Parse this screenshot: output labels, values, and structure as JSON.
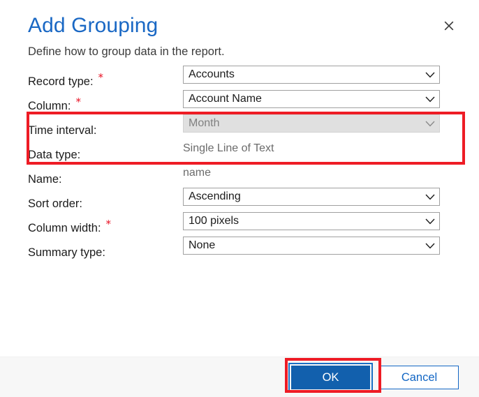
{
  "dialog": {
    "title": "Add Grouping",
    "subtitle": "Define how to group data in the report.",
    "close_icon": "close-icon"
  },
  "form": {
    "rows": [
      {
        "label": "Record type:",
        "required": true,
        "control": "combobox",
        "value": "Accounts",
        "disabled": false,
        "name": "record-type"
      },
      {
        "label": "Column:",
        "required": true,
        "control": "combobox",
        "value": "Account Name",
        "disabled": false,
        "name": "column"
      },
      {
        "label": "Time interval:",
        "required": false,
        "control": "combobox",
        "value": "Month",
        "disabled": true,
        "name": "time-interval"
      },
      {
        "label": "Data type:",
        "required": false,
        "control": "text",
        "value": "Single Line of Text",
        "disabled": false,
        "name": "data-type"
      },
      {
        "label": "Name:",
        "required": false,
        "control": "text",
        "value": "name",
        "disabled": false,
        "name": "name"
      },
      {
        "label": "Sort order:",
        "required": false,
        "control": "combobox",
        "value": "Ascending",
        "disabled": false,
        "name": "sort-order"
      },
      {
        "label": "Column width:",
        "required": true,
        "control": "combobox",
        "value": "100 pixels",
        "disabled": false,
        "name": "column-width"
      },
      {
        "label": "Summary type:",
        "required": false,
        "control": "combobox",
        "value": "None",
        "disabled": false,
        "name": "summary-type"
      }
    ],
    "required_marker": "*"
  },
  "footer": {
    "ok_label": "OK",
    "cancel_label": "Cancel"
  },
  "annotations": [
    {
      "name": "highlight-required-fields"
    },
    {
      "name": "highlight-ok-button"
    }
  ],
  "colors": {
    "title_blue": "#1a68c4",
    "accent_blue": "#1260ad",
    "link_blue": "#1266c4",
    "required_red": "#e81123",
    "annotation_red": "#ee1c25",
    "footer_bg": "#f7f7f7",
    "disabled_bg": "#e0e0e0"
  }
}
